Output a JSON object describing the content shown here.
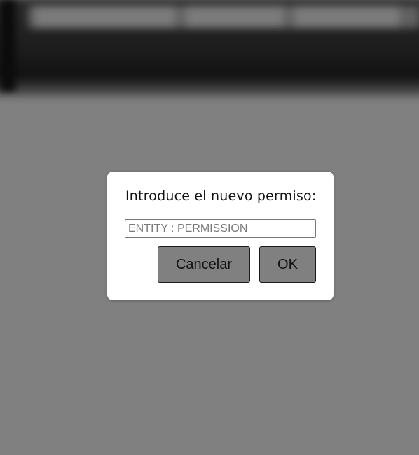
{
  "dialog": {
    "title": "Introduce el nuevo permiso:",
    "input": {
      "value": "",
      "placeholder": "ENTITY : PERMISSION"
    },
    "cancel_label": "Cancelar",
    "ok_label": "OK"
  },
  "colors": {
    "overlay": "#808080",
    "dialog_bg": "#ffffff",
    "button_bg": "#808080",
    "button_border": "#1a1a1a",
    "header_bg": "#1c1c1c"
  }
}
